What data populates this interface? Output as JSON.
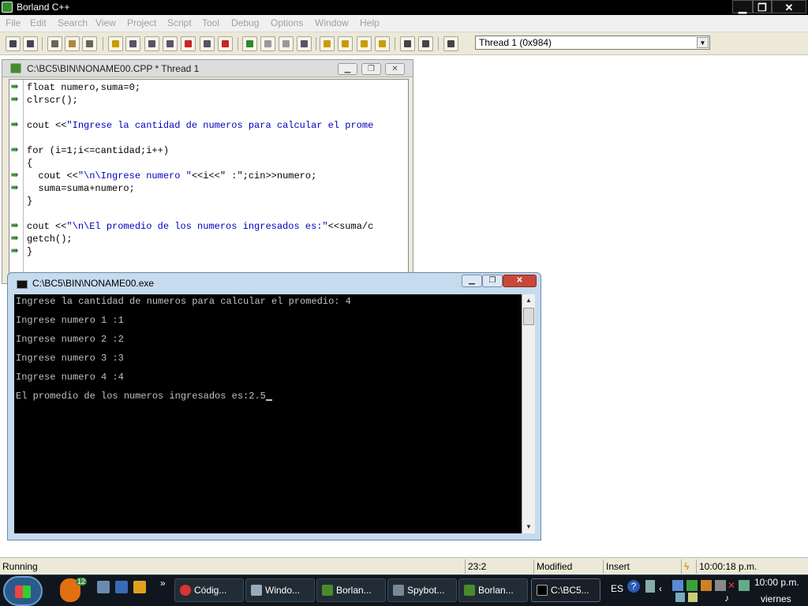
{
  "window": {
    "title": "Borland C++",
    "min": "▁",
    "max": "❐",
    "close": "✕"
  },
  "menu": [
    "File",
    "Edit",
    "Search",
    "View",
    "Project",
    "Script",
    "Tool",
    "Debug",
    "Options",
    "Window",
    "Help"
  ],
  "thread_select": "Thread 1 (0x984)",
  "editor": {
    "title": "C:\\BC5\\BIN\\NONAME00.CPP * Thread 1",
    "lines": [
      {
        "bp": true,
        "pre": "float numero,suma=0;",
        "str": "",
        "post": ""
      },
      {
        "bp": true,
        "pre": "clrscr();",
        "str": "",
        "post": ""
      },
      {
        "bp": false,
        "pre": "",
        "str": "",
        "post": ""
      },
      {
        "bp": true,
        "pre": "cout <<",
        "str": "\"Ingrese la cantidad de numeros para calcular el prome",
        "post": ""
      },
      {
        "bp": false,
        "pre": "",
        "str": "",
        "post": ""
      },
      {
        "bp": true,
        "pre": "for (i=1;i<=cantidad;i++)",
        "str": "",
        "post": ""
      },
      {
        "bp": false,
        "pre": "{",
        "str": "",
        "post": ""
      },
      {
        "bp": true,
        "pre": "  cout <<",
        "str": "\"\\n\\Ingrese numero \"",
        "post": "<<i<<\" :\";cin>>numero;"
      },
      {
        "bp": true,
        "pre": "  suma=suma+numero;",
        "str": "",
        "post": ""
      },
      {
        "bp": false,
        "pre": "}",
        "str": "",
        "post": ""
      },
      {
        "bp": false,
        "pre": "",
        "str": "",
        "post": ""
      },
      {
        "bp": true,
        "pre": "cout <<",
        "str": "\"\\n\\El promedio de los numeros ingresados es:\"",
        "post": "<<suma/c"
      },
      {
        "bp": true,
        "pre": "getch();",
        "str": "",
        "post": ""
      },
      {
        "bp": true,
        "pre": "}",
        "str": "",
        "post": ""
      }
    ]
  },
  "console": {
    "title": "C:\\BC5\\BIN\\NONAME00.exe",
    "lines": [
      "Ingrese la cantidad de numeros para calcular el promedio: 4",
      "",
      "Ingrese numero 1 :1",
      "",
      "Ingrese numero 2 :2",
      "",
      "Ingrese numero 3 :3",
      "",
      "Ingrese numero 4 :4",
      "",
      "El promedio de los numeros ingresados es:2.5"
    ]
  },
  "status": {
    "state": "Running",
    "position": "23:2",
    "modified": "Modified",
    "mode": "Insert",
    "time": "10:00:18 p.m."
  },
  "taskbar": {
    "badge": "12",
    "tasks": [
      "Códig...",
      "Windo...",
      "Borlan...",
      "Spybot...",
      "Borlan...",
      "C:\\BC5..."
    ],
    "lang": "ES",
    "clock_time": "10:00 p.m.",
    "clock_day": "viernes"
  }
}
